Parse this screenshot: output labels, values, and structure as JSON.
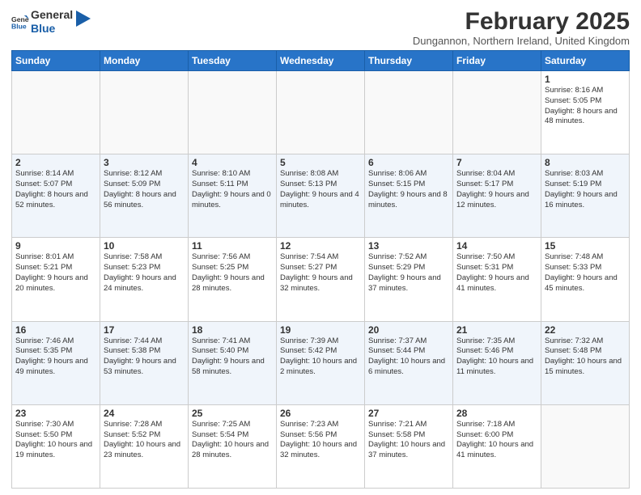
{
  "logo": {
    "text_general": "General",
    "text_blue": "Blue"
  },
  "header": {
    "month_title": "February 2025",
    "location": "Dungannon, Northern Ireland, United Kingdom"
  },
  "weekdays": [
    "Sunday",
    "Monday",
    "Tuesday",
    "Wednesday",
    "Thursday",
    "Friday",
    "Saturday"
  ],
  "weeks": [
    [
      {
        "day": "",
        "info": ""
      },
      {
        "day": "",
        "info": ""
      },
      {
        "day": "",
        "info": ""
      },
      {
        "day": "",
        "info": ""
      },
      {
        "day": "",
        "info": ""
      },
      {
        "day": "",
        "info": ""
      },
      {
        "day": "1",
        "info": "Sunrise: 8:16 AM\nSunset: 5:05 PM\nDaylight: 8 hours and 48 minutes."
      }
    ],
    [
      {
        "day": "2",
        "info": "Sunrise: 8:14 AM\nSunset: 5:07 PM\nDaylight: 8 hours and 52 minutes."
      },
      {
        "day": "3",
        "info": "Sunrise: 8:12 AM\nSunset: 5:09 PM\nDaylight: 8 hours and 56 minutes."
      },
      {
        "day": "4",
        "info": "Sunrise: 8:10 AM\nSunset: 5:11 PM\nDaylight: 9 hours and 0 minutes."
      },
      {
        "day": "5",
        "info": "Sunrise: 8:08 AM\nSunset: 5:13 PM\nDaylight: 9 hours and 4 minutes."
      },
      {
        "day": "6",
        "info": "Sunrise: 8:06 AM\nSunset: 5:15 PM\nDaylight: 9 hours and 8 minutes."
      },
      {
        "day": "7",
        "info": "Sunrise: 8:04 AM\nSunset: 5:17 PM\nDaylight: 9 hours and 12 minutes."
      },
      {
        "day": "8",
        "info": "Sunrise: 8:03 AM\nSunset: 5:19 PM\nDaylight: 9 hours and 16 minutes."
      }
    ],
    [
      {
        "day": "9",
        "info": "Sunrise: 8:01 AM\nSunset: 5:21 PM\nDaylight: 9 hours and 20 minutes."
      },
      {
        "day": "10",
        "info": "Sunrise: 7:58 AM\nSunset: 5:23 PM\nDaylight: 9 hours and 24 minutes."
      },
      {
        "day": "11",
        "info": "Sunrise: 7:56 AM\nSunset: 5:25 PM\nDaylight: 9 hours and 28 minutes."
      },
      {
        "day": "12",
        "info": "Sunrise: 7:54 AM\nSunset: 5:27 PM\nDaylight: 9 hours and 32 minutes."
      },
      {
        "day": "13",
        "info": "Sunrise: 7:52 AM\nSunset: 5:29 PM\nDaylight: 9 hours and 37 minutes."
      },
      {
        "day": "14",
        "info": "Sunrise: 7:50 AM\nSunset: 5:31 PM\nDaylight: 9 hours and 41 minutes."
      },
      {
        "day": "15",
        "info": "Sunrise: 7:48 AM\nSunset: 5:33 PM\nDaylight: 9 hours and 45 minutes."
      }
    ],
    [
      {
        "day": "16",
        "info": "Sunrise: 7:46 AM\nSunset: 5:35 PM\nDaylight: 9 hours and 49 minutes."
      },
      {
        "day": "17",
        "info": "Sunrise: 7:44 AM\nSunset: 5:38 PM\nDaylight: 9 hours and 53 minutes."
      },
      {
        "day": "18",
        "info": "Sunrise: 7:41 AM\nSunset: 5:40 PM\nDaylight: 9 hours and 58 minutes."
      },
      {
        "day": "19",
        "info": "Sunrise: 7:39 AM\nSunset: 5:42 PM\nDaylight: 10 hours and 2 minutes."
      },
      {
        "day": "20",
        "info": "Sunrise: 7:37 AM\nSunset: 5:44 PM\nDaylight: 10 hours and 6 minutes."
      },
      {
        "day": "21",
        "info": "Sunrise: 7:35 AM\nSunset: 5:46 PM\nDaylight: 10 hours and 11 minutes."
      },
      {
        "day": "22",
        "info": "Sunrise: 7:32 AM\nSunset: 5:48 PM\nDaylight: 10 hours and 15 minutes."
      }
    ],
    [
      {
        "day": "23",
        "info": "Sunrise: 7:30 AM\nSunset: 5:50 PM\nDaylight: 10 hours and 19 minutes."
      },
      {
        "day": "24",
        "info": "Sunrise: 7:28 AM\nSunset: 5:52 PM\nDaylight: 10 hours and 23 minutes."
      },
      {
        "day": "25",
        "info": "Sunrise: 7:25 AM\nSunset: 5:54 PM\nDaylight: 10 hours and 28 minutes."
      },
      {
        "day": "26",
        "info": "Sunrise: 7:23 AM\nSunset: 5:56 PM\nDaylight: 10 hours and 32 minutes."
      },
      {
        "day": "27",
        "info": "Sunrise: 7:21 AM\nSunset: 5:58 PM\nDaylight: 10 hours and 37 minutes."
      },
      {
        "day": "28",
        "info": "Sunrise: 7:18 AM\nSunset: 6:00 PM\nDaylight: 10 hours and 41 minutes."
      },
      {
        "day": "",
        "info": ""
      }
    ]
  ]
}
